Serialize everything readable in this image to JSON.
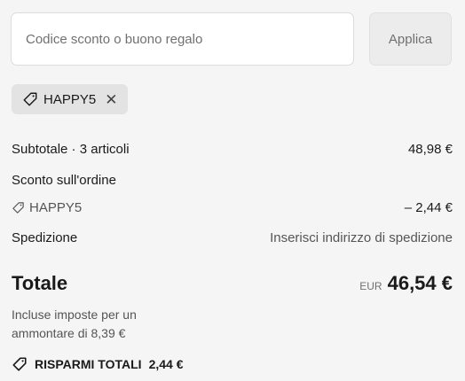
{
  "discount": {
    "placeholder": "Codice sconto o buono regalo",
    "apply_label": "Applica",
    "applied_code": "HAPPY5",
    "remove_glyph": "✕"
  },
  "summary": {
    "subtotal_label": "Subtotale · 3 articoli",
    "subtotal_value": "48,98 €",
    "order_discount_label": "Sconto sull'ordine",
    "discount_code": "HAPPY5",
    "discount_value": "– 2,44 €",
    "shipping_label": "Spedizione",
    "shipping_value": "Inserisci indirizzo di spedizione"
  },
  "total": {
    "label": "Totale",
    "currency": "EUR",
    "amount": "46,54 €",
    "tax_note": "Incluse imposte per un ammontare di 8,39 €"
  },
  "savings": {
    "label": "RISPARMI TOTALI",
    "value": "2,44 €"
  },
  "icons": [
    "tag-icon",
    "close-icon",
    "tag-icon",
    "savings-tag-icon"
  ]
}
